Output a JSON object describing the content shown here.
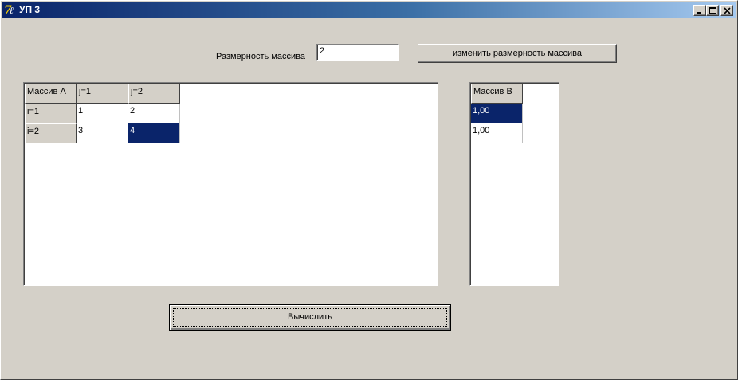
{
  "window": {
    "title": "УП 3",
    "titlebar_colors": [
      "#0a246a",
      "#a6caf0"
    ],
    "face_color": "#d4d0c8",
    "icon": "app-icon"
  },
  "size_control": {
    "label": "Размерность массива",
    "value": "2",
    "change_button": "изменить размерность массива"
  },
  "grid_a": {
    "corner": "Массив A",
    "col_headers": [
      "j=1",
      "j=2"
    ],
    "rows": [
      {
        "header": "i=1",
        "cells": [
          "1",
          "2"
        ]
      },
      {
        "header": "i=2",
        "cells": [
          "3",
          "4"
        ]
      }
    ],
    "selected_cell": "row 2, column j=2"
  },
  "grid_b": {
    "header": "Массив B",
    "cells": [
      "1,00",
      "1,00"
    ],
    "selected_row": 1
  },
  "compute_button": "Вычислить",
  "selection_color": "#0a246a"
}
